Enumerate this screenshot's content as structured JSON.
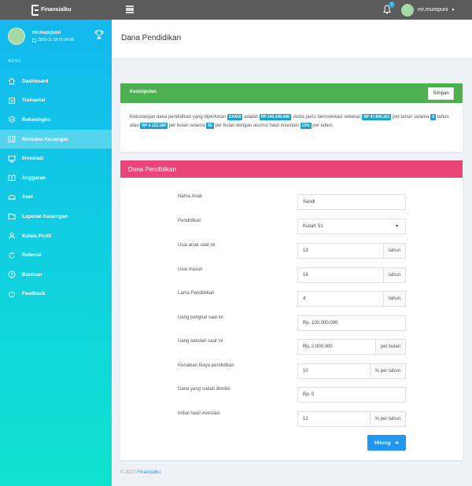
{
  "topbar": {
    "brand_name": "Finansialku",
    "brand_tagline": "",
    "notification_count": "3",
    "user_name": "mr.mumpuni"
  },
  "sidebar": {
    "profile_name": "mr.mumpuni",
    "profile_date": "2015-11-18 01:04:08",
    "menu_title": "MENU",
    "items": [
      {
        "label": "Dashboard",
        "icon": "home-icon"
      },
      {
        "label": "Transaksi",
        "icon": "list-icon"
      },
      {
        "label": "Rekeningku",
        "icon": "layers-icon"
      },
      {
        "label": "Rencana Keuangan",
        "icon": "map-icon",
        "active": true
      },
      {
        "label": "Investasi",
        "icon": "monitor-icon"
      },
      {
        "label": "Anggaran",
        "icon": "book-icon"
      },
      {
        "label": "Aset",
        "icon": "car-icon"
      },
      {
        "label": "Laporan Keuangan",
        "icon": "folder-icon"
      },
      {
        "label": "Kelola Profil",
        "icon": "user-icon"
      },
      {
        "label": "Referral",
        "icon": "refresh-icon"
      },
      {
        "label": "Bantuan",
        "icon": "help-icon"
      },
      {
        "label": "Feedback",
        "icon": "power-icon"
      }
    ]
  },
  "page": {
    "title": "Dana Pendidikan"
  },
  "summary": {
    "header": "Kesimpulan",
    "save_label": "Simpan",
    "t1": "Kekurangan dana pendidikan yang diperlukan",
    "child": "SANDI",
    "t2": "adalah",
    "shortfall": "RP 240.436.046",
    "t3": ". Anda perlu berinvestasi sebesar",
    "yearly": "RP 47.846.261",
    "t4": "per tahun selama",
    "years": "5",
    "t5": "tahun",
    "t6": "atau",
    "monthly": "RP 4.122.180",
    "t7": "per bulan selama",
    "months": "60",
    "t8": "per bulan dengan asumsi hasil investasi",
    "rate": "12%",
    "t9": "per tahun."
  },
  "form": {
    "header": "Dana Pendidikan",
    "fields": [
      {
        "label": "Nama Anak",
        "value": "Sandi",
        "addon": ""
      },
      {
        "label": "Pendidikan",
        "value": "Kuliah S1",
        "addon": ""
      },
      {
        "label": "Usia anak saat ini",
        "value": "13",
        "addon": "tahun"
      },
      {
        "label": "Usia masuk",
        "value": "18",
        "addon": "tahun"
      },
      {
        "label": "Lama Pendidikan",
        "value": "4",
        "addon": "tahun"
      },
      {
        "label": "Uang pangkal saat ini",
        "value": "Rp. 100.000.000",
        "addon": ""
      },
      {
        "label": "Uang sekolah saat ini",
        "value": "Rp. 2.000.000",
        "addon": "per bulan"
      },
      {
        "label": "Kenaikan biaya pendidikan",
        "value": "10",
        "addon": "% per tahun"
      },
      {
        "label": "Dana yang sudah dimiliki",
        "value": "Rp. 0",
        "addon": ""
      },
      {
        "label": "Imbal hasil investasi",
        "value": "12",
        "addon": "% per tahun"
      }
    ],
    "submit_label": "Hitung"
  },
  "footer": {
    "copyright": "© 2017",
    "link": "Finansialku"
  },
  "colors": {
    "topbar": "#5b5b5b",
    "sidebar_top": "#13b8ee",
    "sidebar_bottom": "#0fe3cf",
    "summary_header": "#4caf50",
    "form_header": "#ea4579",
    "tag": "#17a2d0",
    "primary_button": "#2196f3"
  }
}
